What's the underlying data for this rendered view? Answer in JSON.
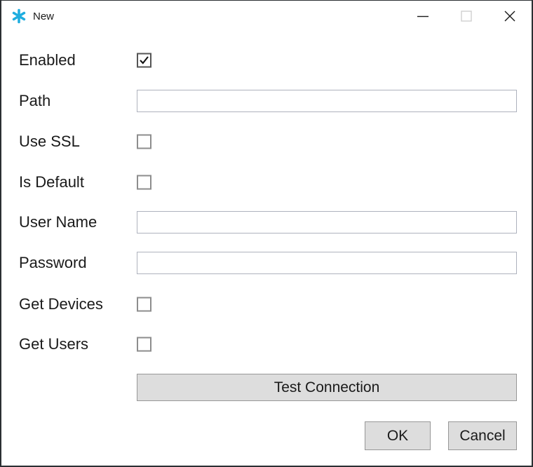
{
  "window": {
    "title": "New",
    "icon": "asterisk-icon",
    "accent_color": "#1FADDF",
    "border_color": "#2b2f33",
    "background": "#ffffff"
  },
  "titlebar": {
    "minimize_label": "Minimize",
    "maximize_label": "Maximize",
    "close_label": "Close",
    "maximize_disabled": true
  },
  "form": {
    "rows": [
      {
        "label": "Enabled",
        "control": "checkbox",
        "checked": true,
        "value": ""
      },
      {
        "label": "Path",
        "control": "textbox",
        "checked": false,
        "value": "",
        "placeholder": ""
      },
      {
        "label": "Use SSL",
        "control": "checkbox",
        "checked": false,
        "value": ""
      },
      {
        "label": "Is Default",
        "control": "checkbox",
        "checked": false,
        "value": ""
      },
      {
        "label": "User Name",
        "control": "textbox",
        "checked": false,
        "value": "",
        "placeholder": ""
      },
      {
        "label": "Password",
        "control": "textbox",
        "checked": false,
        "value": "",
        "placeholder": ""
      },
      {
        "label": "Get Devices",
        "control": "checkbox",
        "checked": false,
        "value": ""
      },
      {
        "label": "Get Users",
        "control": "checkbox",
        "checked": false,
        "value": ""
      }
    ]
  },
  "buttons": {
    "test_connection": "Test Connection",
    "ok": "OK",
    "cancel": "Cancel",
    "face_color": "#dddddd",
    "border_color": "#979797"
  }
}
